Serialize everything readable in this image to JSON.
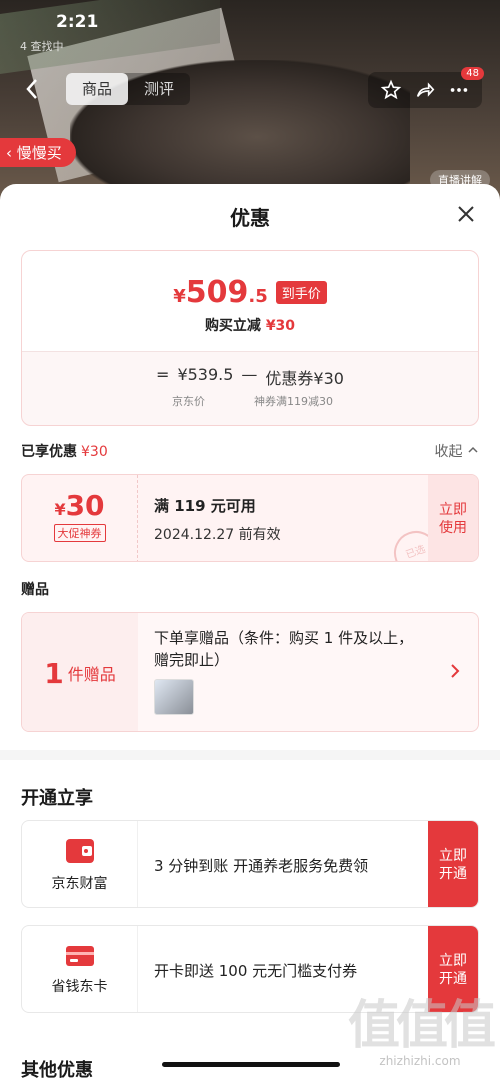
{
  "status": {
    "time": "2:21",
    "sub": "4 查找中"
  },
  "nav": {
    "tabs": [
      {
        "label": "商品"
      },
      {
        "label": "测评"
      }
    ],
    "badge": "48"
  },
  "slow_buy": "慢慢买",
  "live_tag": "直播讲解",
  "sheet": {
    "title": "优惠",
    "price": {
      "currency": "¥",
      "int": "509",
      "dec": ".5",
      "tag": "到手价"
    },
    "reduce": {
      "text": "购买立减",
      "amount": "¥30"
    },
    "calc": {
      "eq": "=",
      "jd_price": "¥539.5",
      "minus": "—",
      "coupon": "优惠券¥30",
      "jd_label": "京东价",
      "coupon_label": "神券满119减30"
    }
  },
  "enjoyed": {
    "title": "已享优惠",
    "amount": "¥30",
    "collapse": "收起"
  },
  "coupon": {
    "currency": "¥",
    "amount": "30",
    "tag": "大促神券",
    "line1": "满 119 元可用",
    "line2": "2024.12.27 前有效",
    "action": "立即使用",
    "stamp": "已选"
  },
  "gift": {
    "title": "赠品",
    "count": "1",
    "count_label": "件赠品",
    "desc": "下单享赠品（条件：购买 1 件及以上，赠完即止）"
  },
  "open": {
    "title": "开通立享"
  },
  "services": [
    {
      "name": "京东财富",
      "text": "3 分钟到账 开通养老服务免费领",
      "action": "立即开通",
      "color": "#e4393c"
    },
    {
      "name": "省钱东卡",
      "text": "开卡即送 100 元无门槛支付券",
      "action": "立即开通",
      "color": "#e4393c"
    }
  ],
  "other": {
    "title": "其他优惠"
  },
  "watermark": {
    "logo": "值值值",
    "url": "zhizhizhi.com"
  }
}
